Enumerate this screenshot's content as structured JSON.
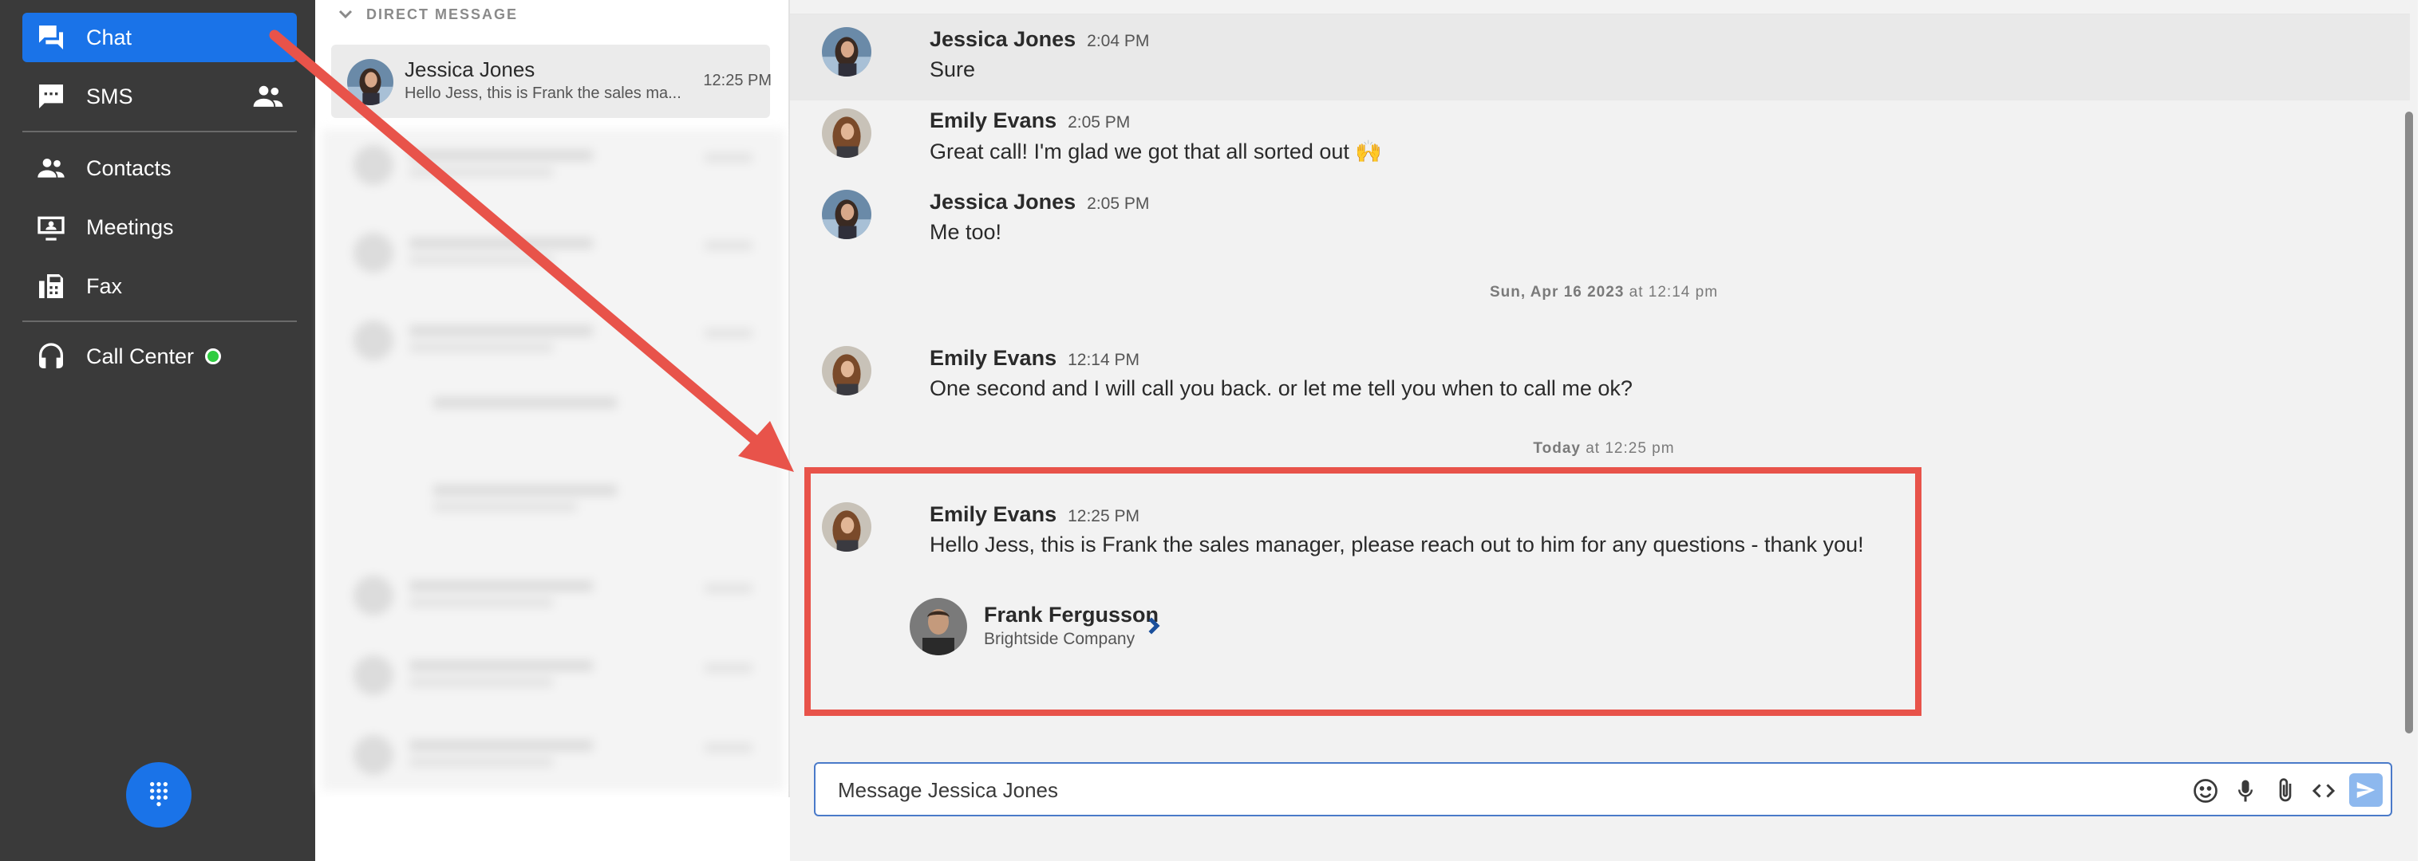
{
  "nav": {
    "items": [
      {
        "label": "Chat",
        "icon": "chat-icon",
        "active": true
      },
      {
        "label": "SMS",
        "icon": "sms-icon",
        "trailing_icon": "group-icon"
      },
      {
        "label": "Contacts",
        "icon": "contacts-icon"
      },
      {
        "label": "Meetings",
        "icon": "meetings-icon"
      },
      {
        "label": "Fax",
        "icon": "fax-icon"
      },
      {
        "label": "Call Center",
        "icon": "headset-icon",
        "status": "online"
      }
    ],
    "accent_color": "#1a73e8",
    "status_color": "#2ecc40"
  },
  "conversations": {
    "section_header": "DIRECT MESSAGE",
    "active": {
      "name": "Jessica Jones",
      "time": "12:25 PM",
      "preview": "Hello Jess, this is Frank the sales ma..."
    }
  },
  "messages": [
    {
      "sender": "Jessica Jones",
      "time": "2:04 PM",
      "text": "Sure"
    },
    {
      "sender": "Emily Evans",
      "time": "2:05 PM",
      "text": "Great call!  I'm glad we got that all sorted out 🙌"
    },
    {
      "sender": "Jessica Jones",
      "time": "2:05 PM",
      "text": "Me too!"
    },
    {
      "sender": "Emily Evans",
      "time": "12:14 PM",
      "text": "One second and I will call you back.  or let me tell you when to call me ok?"
    },
    {
      "sender": "Emily Evans",
      "time": "12:25 PM",
      "text": "Hello Jess, this is Frank the sales manager, please reach out to him for any questions - thank you!"
    }
  ],
  "date_separators": [
    {
      "day": "Sun, Apr 16 2023",
      "at": "at 12:14 pm"
    },
    {
      "day": "Today",
      "at": "at 12:25 pm"
    }
  ],
  "contact_card": {
    "name": "Frank Fergusson",
    "company": "Brightside Company"
  },
  "composer": {
    "placeholder": "Message Jessica Jones",
    "icons": [
      "emoji-icon",
      "microphone-icon",
      "attachment-icon",
      "code-icon",
      "send-icon"
    ]
  },
  "annotation": {
    "color": "#e8534a"
  }
}
